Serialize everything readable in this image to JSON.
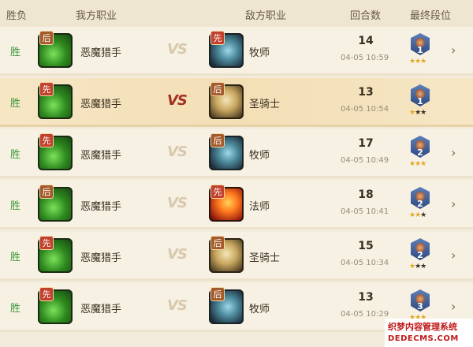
{
  "header": {
    "result": "胜负",
    "my_class": "我方职业",
    "enemy_class": "敌方职业",
    "turns": "回合数",
    "final_rank": "最终段位"
  },
  "vs_label": "VS",
  "rows": [
    {
      "result": "胜",
      "my_order": "后",
      "my_class": "恶魔猎手",
      "enemy_order": "先",
      "enemy_class": "牧师",
      "turns": "14",
      "time": "04-05 10:59",
      "rank": "1",
      "stars": 3,
      "highlight": false
    },
    {
      "result": "胜",
      "my_order": "先",
      "my_class": "恶魔猎手",
      "enemy_order": "后",
      "enemy_class": "圣骑士",
      "turns": "13",
      "time": "04-05 10:54",
      "rank": "1",
      "stars": 1,
      "highlight": true
    },
    {
      "result": "胜",
      "my_order": "先",
      "my_class": "恶魔猎手",
      "enemy_order": "后",
      "enemy_class": "牧师",
      "turns": "17",
      "time": "04-05 10:49",
      "rank": "2",
      "stars": 3,
      "highlight": false
    },
    {
      "result": "胜",
      "my_order": "后",
      "my_class": "恶魔猎手",
      "enemy_order": "先",
      "enemy_class": "法师",
      "turns": "18",
      "time": "04-05 10:41",
      "rank": "2",
      "stars": 2,
      "highlight": false
    },
    {
      "result": "胜",
      "my_order": "先",
      "my_class": "恶魔猎手",
      "enemy_order": "后",
      "enemy_class": "圣骑士",
      "turns": "15",
      "time": "04-05 10:34",
      "rank": "2",
      "stars": 1,
      "highlight": false
    },
    {
      "result": "胜",
      "my_order": "先",
      "my_class": "恶魔猎手",
      "enemy_order": "后",
      "enemy_class": "牧师",
      "turns": "13",
      "time": "04-05 10:29",
      "rank": "3",
      "stars": 3,
      "highlight": false
    }
  ],
  "watermark": {
    "line1": "织梦内容管理系统",
    "line2": "DEDECMS.COM"
  },
  "colors": {
    "win": "#3f9a3a",
    "vs_active": "#a23022",
    "star_on": "#e2a81f"
  }
}
